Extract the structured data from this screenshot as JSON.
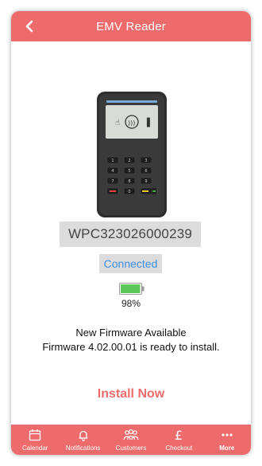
{
  "header": {
    "title": "EMV Reader",
    "back_icon": "chevron-left-icon"
  },
  "device": {
    "serial": "WPC323026000239",
    "status": "Connected",
    "battery_percent": "98%",
    "battery_level": 0.98
  },
  "firmware": {
    "title": "New Firmware Available",
    "message": "Firmware 4.02.00.01 is ready to install."
  },
  "actions": {
    "install_label": "Install Now"
  },
  "tabs": [
    {
      "label": "Calendar",
      "icon": "calendar-icon"
    },
    {
      "label": "Notifications",
      "icon": "bell-icon"
    },
    {
      "label": "Customers",
      "icon": "people-icon"
    },
    {
      "label": "Checkout",
      "icon": "pound-icon"
    },
    {
      "label": "More",
      "icon": "more-icon"
    }
  ],
  "colors": {
    "accent": "#ee6b6b",
    "link": "#3c8ee0",
    "battery": "#5cc858"
  }
}
